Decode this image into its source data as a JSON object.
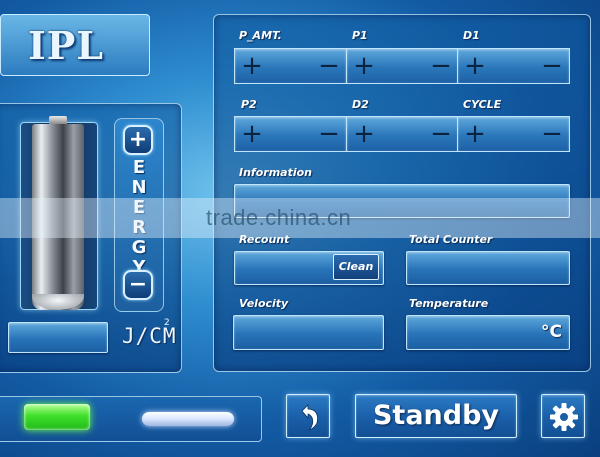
{
  "logo": {
    "text": "IPL"
  },
  "energy": {
    "plus_label": "+",
    "minus_label": "−",
    "word_letters": [
      "E",
      "N",
      "E",
      "R",
      "G",
      "Y"
    ],
    "value": "",
    "unit": "J/CM",
    "unit_superscript": "2"
  },
  "steppers": [
    {
      "label": "P_AMT.",
      "plus": "+",
      "minus": "−"
    },
    {
      "label": "P1",
      "plus": "+",
      "minus": "−"
    },
    {
      "label": "D1",
      "plus": "+",
      "minus": "−"
    },
    {
      "label": "P2",
      "plus": "+",
      "minus": "−"
    },
    {
      "label": "D2",
      "plus": "+",
      "minus": "−"
    },
    {
      "label": "CYCLE",
      "plus": "+",
      "minus": "−"
    }
  ],
  "fields": {
    "information_label": "Information",
    "information_value": "",
    "recount_label": "Recount",
    "recount_value": "",
    "clean_label": "Clean",
    "total_counter_label": "Total Counter",
    "total_counter_value": "",
    "velocity_label": "Velocity",
    "velocity_value": "",
    "temperature_label": "Temperature",
    "temperature_unit": "°C",
    "temperature_value": ""
  },
  "watermark": {
    "text": "trade.china.cn"
  },
  "bottom": {
    "standby_label": "Standby",
    "back_icon": "back-arrow-icon",
    "settings_icon": "gear-icon",
    "status_color": "#3fe02a"
  }
}
